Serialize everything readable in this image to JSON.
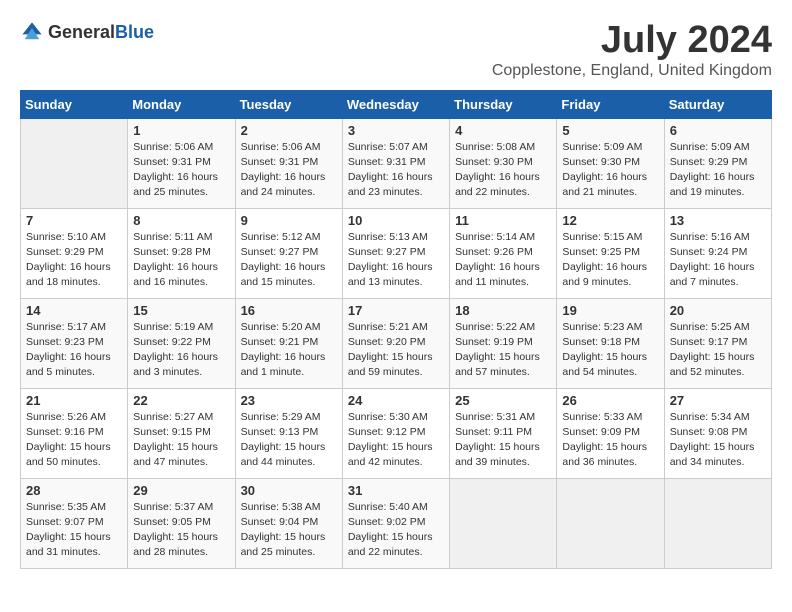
{
  "header": {
    "logo_general": "General",
    "logo_blue": "Blue",
    "month_year": "July 2024",
    "location": "Copplestone, England, United Kingdom"
  },
  "days_of_week": [
    "Sunday",
    "Monday",
    "Tuesday",
    "Wednesday",
    "Thursday",
    "Friday",
    "Saturday"
  ],
  "weeks": [
    [
      {
        "num": "",
        "lines": []
      },
      {
        "num": "1",
        "lines": [
          "Sunrise: 5:06 AM",
          "Sunset: 9:31 PM",
          "Daylight: 16 hours",
          "and 25 minutes."
        ]
      },
      {
        "num": "2",
        "lines": [
          "Sunrise: 5:06 AM",
          "Sunset: 9:31 PM",
          "Daylight: 16 hours",
          "and 24 minutes."
        ]
      },
      {
        "num": "3",
        "lines": [
          "Sunrise: 5:07 AM",
          "Sunset: 9:31 PM",
          "Daylight: 16 hours",
          "and 23 minutes."
        ]
      },
      {
        "num": "4",
        "lines": [
          "Sunrise: 5:08 AM",
          "Sunset: 9:30 PM",
          "Daylight: 16 hours",
          "and 22 minutes."
        ]
      },
      {
        "num": "5",
        "lines": [
          "Sunrise: 5:09 AM",
          "Sunset: 9:30 PM",
          "Daylight: 16 hours",
          "and 21 minutes."
        ]
      },
      {
        "num": "6",
        "lines": [
          "Sunrise: 5:09 AM",
          "Sunset: 9:29 PM",
          "Daylight: 16 hours",
          "and 19 minutes."
        ]
      }
    ],
    [
      {
        "num": "7",
        "lines": [
          "Sunrise: 5:10 AM",
          "Sunset: 9:29 PM",
          "Daylight: 16 hours",
          "and 18 minutes."
        ]
      },
      {
        "num": "8",
        "lines": [
          "Sunrise: 5:11 AM",
          "Sunset: 9:28 PM",
          "Daylight: 16 hours",
          "and 16 minutes."
        ]
      },
      {
        "num": "9",
        "lines": [
          "Sunrise: 5:12 AM",
          "Sunset: 9:27 PM",
          "Daylight: 16 hours",
          "and 15 minutes."
        ]
      },
      {
        "num": "10",
        "lines": [
          "Sunrise: 5:13 AM",
          "Sunset: 9:27 PM",
          "Daylight: 16 hours",
          "and 13 minutes."
        ]
      },
      {
        "num": "11",
        "lines": [
          "Sunrise: 5:14 AM",
          "Sunset: 9:26 PM",
          "Daylight: 16 hours",
          "and 11 minutes."
        ]
      },
      {
        "num": "12",
        "lines": [
          "Sunrise: 5:15 AM",
          "Sunset: 9:25 PM",
          "Daylight: 16 hours",
          "and 9 minutes."
        ]
      },
      {
        "num": "13",
        "lines": [
          "Sunrise: 5:16 AM",
          "Sunset: 9:24 PM",
          "Daylight: 16 hours",
          "and 7 minutes."
        ]
      }
    ],
    [
      {
        "num": "14",
        "lines": [
          "Sunrise: 5:17 AM",
          "Sunset: 9:23 PM",
          "Daylight: 16 hours",
          "and 5 minutes."
        ]
      },
      {
        "num": "15",
        "lines": [
          "Sunrise: 5:19 AM",
          "Sunset: 9:22 PM",
          "Daylight: 16 hours",
          "and 3 minutes."
        ]
      },
      {
        "num": "16",
        "lines": [
          "Sunrise: 5:20 AM",
          "Sunset: 9:21 PM",
          "Daylight: 16 hours",
          "and 1 minute."
        ]
      },
      {
        "num": "17",
        "lines": [
          "Sunrise: 5:21 AM",
          "Sunset: 9:20 PM",
          "Daylight: 15 hours",
          "and 59 minutes."
        ]
      },
      {
        "num": "18",
        "lines": [
          "Sunrise: 5:22 AM",
          "Sunset: 9:19 PM",
          "Daylight: 15 hours",
          "and 57 minutes."
        ]
      },
      {
        "num": "19",
        "lines": [
          "Sunrise: 5:23 AM",
          "Sunset: 9:18 PM",
          "Daylight: 15 hours",
          "and 54 minutes."
        ]
      },
      {
        "num": "20",
        "lines": [
          "Sunrise: 5:25 AM",
          "Sunset: 9:17 PM",
          "Daylight: 15 hours",
          "and 52 minutes."
        ]
      }
    ],
    [
      {
        "num": "21",
        "lines": [
          "Sunrise: 5:26 AM",
          "Sunset: 9:16 PM",
          "Daylight: 15 hours",
          "and 50 minutes."
        ]
      },
      {
        "num": "22",
        "lines": [
          "Sunrise: 5:27 AM",
          "Sunset: 9:15 PM",
          "Daylight: 15 hours",
          "and 47 minutes."
        ]
      },
      {
        "num": "23",
        "lines": [
          "Sunrise: 5:29 AM",
          "Sunset: 9:13 PM",
          "Daylight: 15 hours",
          "and 44 minutes."
        ]
      },
      {
        "num": "24",
        "lines": [
          "Sunrise: 5:30 AM",
          "Sunset: 9:12 PM",
          "Daylight: 15 hours",
          "and 42 minutes."
        ]
      },
      {
        "num": "25",
        "lines": [
          "Sunrise: 5:31 AM",
          "Sunset: 9:11 PM",
          "Daylight: 15 hours",
          "and 39 minutes."
        ]
      },
      {
        "num": "26",
        "lines": [
          "Sunrise: 5:33 AM",
          "Sunset: 9:09 PM",
          "Daylight: 15 hours",
          "and 36 minutes."
        ]
      },
      {
        "num": "27",
        "lines": [
          "Sunrise: 5:34 AM",
          "Sunset: 9:08 PM",
          "Daylight: 15 hours",
          "and 34 minutes."
        ]
      }
    ],
    [
      {
        "num": "28",
        "lines": [
          "Sunrise: 5:35 AM",
          "Sunset: 9:07 PM",
          "Daylight: 15 hours",
          "and 31 minutes."
        ]
      },
      {
        "num": "29",
        "lines": [
          "Sunrise: 5:37 AM",
          "Sunset: 9:05 PM",
          "Daylight: 15 hours",
          "and 28 minutes."
        ]
      },
      {
        "num": "30",
        "lines": [
          "Sunrise: 5:38 AM",
          "Sunset: 9:04 PM",
          "Daylight: 15 hours",
          "and 25 minutes."
        ]
      },
      {
        "num": "31",
        "lines": [
          "Sunrise: 5:40 AM",
          "Sunset: 9:02 PM",
          "Daylight: 15 hours",
          "and 22 minutes."
        ]
      },
      {
        "num": "",
        "lines": []
      },
      {
        "num": "",
        "lines": []
      },
      {
        "num": "",
        "lines": []
      }
    ]
  ]
}
